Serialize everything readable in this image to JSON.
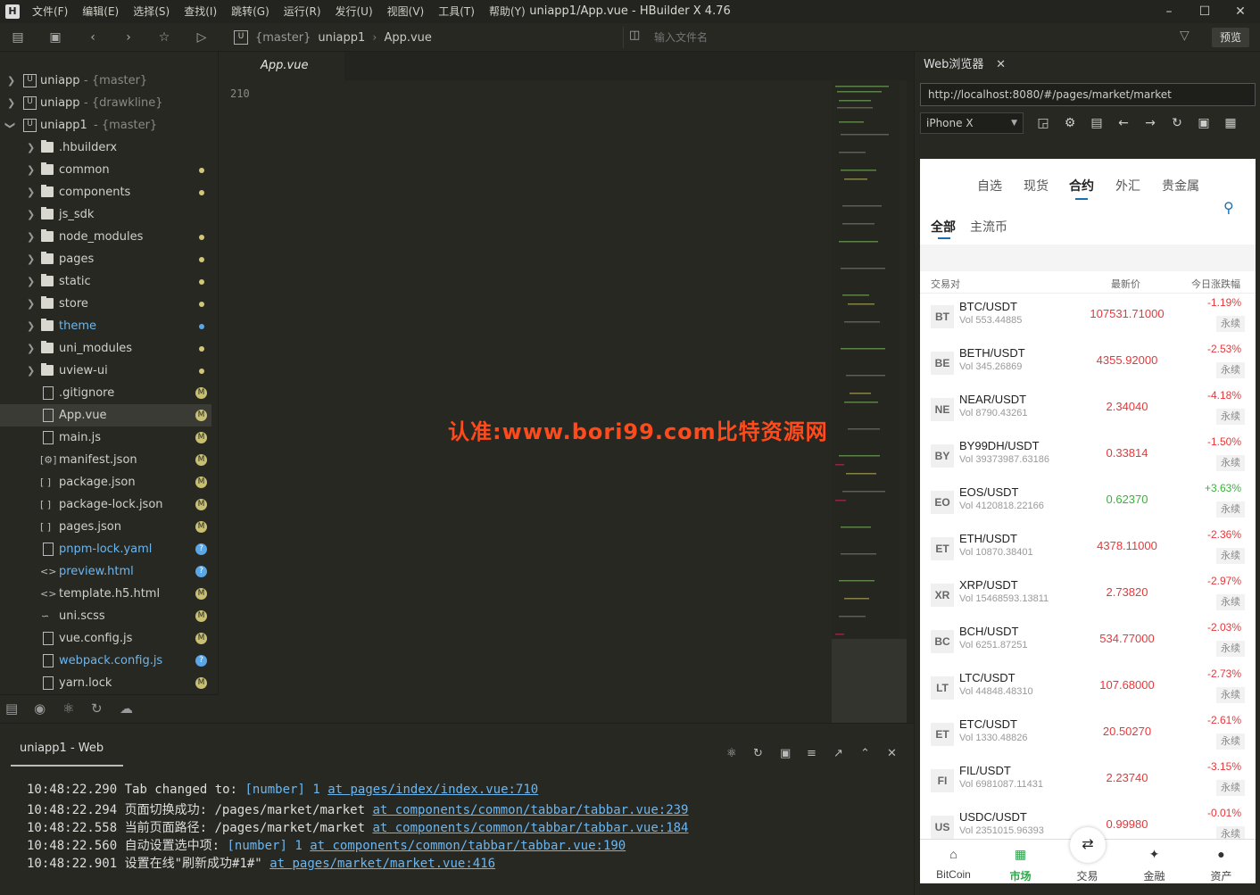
{
  "titlebar": {
    "menus": [
      "文件(F)",
      "编辑(E)",
      "选择(S)",
      "查找(I)",
      "跳转(G)",
      "运行(R)",
      "发行(U)",
      "视图(V)",
      "工具(T)",
      "帮助(Y)"
    ],
    "title": "uniapp1/App.vue - HBuilder X 4.76"
  },
  "toolbar": {
    "crumb_branch": "{master}",
    "crumb_project": "uniapp1",
    "crumb_file": "App.vue",
    "file_search_placeholder": "输入文件名",
    "preview_label": "预览"
  },
  "sidebar": {
    "projects": [
      {
        "name": "uniapp",
        "branch": "- {master}"
      },
      {
        "name": "uniapp",
        "branch": "- {drawkline}"
      },
      {
        "name": "uniapp1",
        "branch": "- {master}"
      }
    ],
    "folders": [
      {
        "name": ".hbuilderx"
      },
      {
        "name": "common"
      },
      {
        "name": "components"
      },
      {
        "name": "js_sdk"
      },
      {
        "name": "node_modules"
      },
      {
        "name": "pages"
      },
      {
        "name": "static"
      },
      {
        "name": "store"
      },
      {
        "name": "theme"
      },
      {
        "name": "uni_modules"
      },
      {
        "name": "uview-ui"
      }
    ],
    "files": [
      {
        "name": ".gitignore",
        "badge": "M"
      },
      {
        "name": "App.vue",
        "badge": "M"
      },
      {
        "name": "main.js",
        "badge": "M"
      },
      {
        "name": "manifest.json",
        "badge": "M"
      },
      {
        "name": "package.json",
        "badge": "M"
      },
      {
        "name": "package-lock.json",
        "badge": "M"
      },
      {
        "name": "pages.json",
        "badge": "M"
      },
      {
        "name": "pnpm-lock.yaml",
        "badge": "?"
      },
      {
        "name": "preview.html",
        "badge": "?"
      },
      {
        "name": "template.h5.html",
        "badge": "M"
      },
      {
        "name": "uni.scss",
        "badge": "M"
      },
      {
        "name": "vue.config.js",
        "badge": "M"
      },
      {
        "name": "webpack.config.js",
        "badge": "?"
      },
      {
        "name": "yarn.lock",
        "badge": "M"
      }
    ]
  },
  "editor": {
    "tab": "App.vue",
    "line_number": "210",
    "watermark": "认准:www.bori99.com比特资源网"
  },
  "browser": {
    "tab": "Web浏览器",
    "url": "http://localhost:8080/#/pages/market/market",
    "device": "iPhone X"
  },
  "phone": {
    "top_tabs": [
      "自选",
      "现货",
      "合约",
      "外汇",
      "贵金属"
    ],
    "sub_tabs": [
      "全部",
      "主流币"
    ],
    "col_pair": "交易对",
    "col_price": "最新价",
    "col_change": "今日涨跌幅",
    "perp_label": "永续",
    "rows": [
      {
        "abbr": "BT",
        "pair": "BTC/USDT",
        "vol": "Vol 553.44885",
        "price": "107531.71000",
        "change": "-1.19%",
        "up": false
      },
      {
        "abbr": "BE",
        "pair": "BETH/USDT",
        "vol": "Vol 345.26869",
        "price": "4355.92000",
        "change": "-2.53%",
        "up": false
      },
      {
        "abbr": "NE",
        "pair": "NEAR/USDT",
        "vol": "Vol 8790.43261",
        "price": "2.34040",
        "change": "-4.18%",
        "up": false
      },
      {
        "abbr": "BY",
        "pair": "BY99DH/USDT",
        "vol": "Vol 39373987.63186",
        "price": "0.33814",
        "change": "-1.50%",
        "up": false
      },
      {
        "abbr": "EO",
        "pair": "EOS/USDT",
        "vol": "Vol 4120818.22166",
        "price": "0.62370",
        "change": "+3.63%",
        "up": true
      },
      {
        "abbr": "ET",
        "pair": "ETH/USDT",
        "vol": "Vol 10870.38401",
        "price": "4378.11000",
        "change": "-2.36%",
        "up": false
      },
      {
        "abbr": "XR",
        "pair": "XRP/USDT",
        "vol": "Vol 15468593.13811",
        "price": "2.73820",
        "change": "-2.97%",
        "up": false
      },
      {
        "abbr": "BC",
        "pair": "BCH/USDT",
        "vol": "Vol 6251.87251",
        "price": "534.77000",
        "change": "-2.03%",
        "up": false
      },
      {
        "abbr": "LT",
        "pair": "LTC/USDT",
        "vol": "Vol 44848.48310",
        "price": "107.68000",
        "change": "-2.73%",
        "up": false
      },
      {
        "abbr": "ET",
        "pair": "ETC/USDT",
        "vol": "Vol 1330.48826",
        "price": "20.50270",
        "change": "-2.61%",
        "up": false
      },
      {
        "abbr": "FI",
        "pair": "FIL/USDT",
        "vol": "Vol 6981087.11431",
        "price": "2.23740",
        "change": "-3.15%",
        "up": false
      },
      {
        "abbr": "US",
        "pair": "USDC/USDT",
        "vol": "Vol 2351015.96393",
        "price": "0.99980",
        "change": "-0.01%",
        "up": false
      }
    ],
    "nav": [
      {
        "label": "BitCoin",
        "icon": "home-icon"
      },
      {
        "label": "市场",
        "icon": "market-icon"
      },
      {
        "label": "交易",
        "icon": "trade-icon"
      },
      {
        "label": "金融",
        "icon": "finance-icon"
      },
      {
        "label": "资产",
        "icon": "user-icon"
      }
    ],
    "colors": {
      "down": "#e8373a",
      "up": "#3bb23b",
      "active_nav": "#2aa84a",
      "accent": "#1a6fb0"
    }
  },
  "console": {
    "tab": "uniapp1 - Web",
    "logs": [
      {
        "time": "10:48:22.290",
        "msg": "Tab changed to:",
        "arg": "[number]",
        "val": "1",
        "link": "at pages/index/index.vue:710"
      },
      {
        "time": "10:48:22.294",
        "msg": "页面切换成功: /pages/market/market",
        "arg": "",
        "val": "",
        "link": "at components/common/tabbar/tabbar.vue:239"
      },
      {
        "time": "10:48:22.558",
        "msg": "当前页面路径: /pages/market/market",
        "arg": "",
        "val": "",
        "link": "at components/common/tabbar/tabbar.vue:184"
      },
      {
        "time": "10:48:22.560",
        "msg": "自动设置选中项:",
        "arg": "[number]",
        "val": "1",
        "link": "at components/common/tabbar/tabbar.vue:190"
      },
      {
        "time": "10:48:22.901",
        "msg": "设置在线\"刷新成功#1#\"",
        "arg": "",
        "val": "",
        "link": "at pages/market/market.vue:416"
      }
    ]
  }
}
